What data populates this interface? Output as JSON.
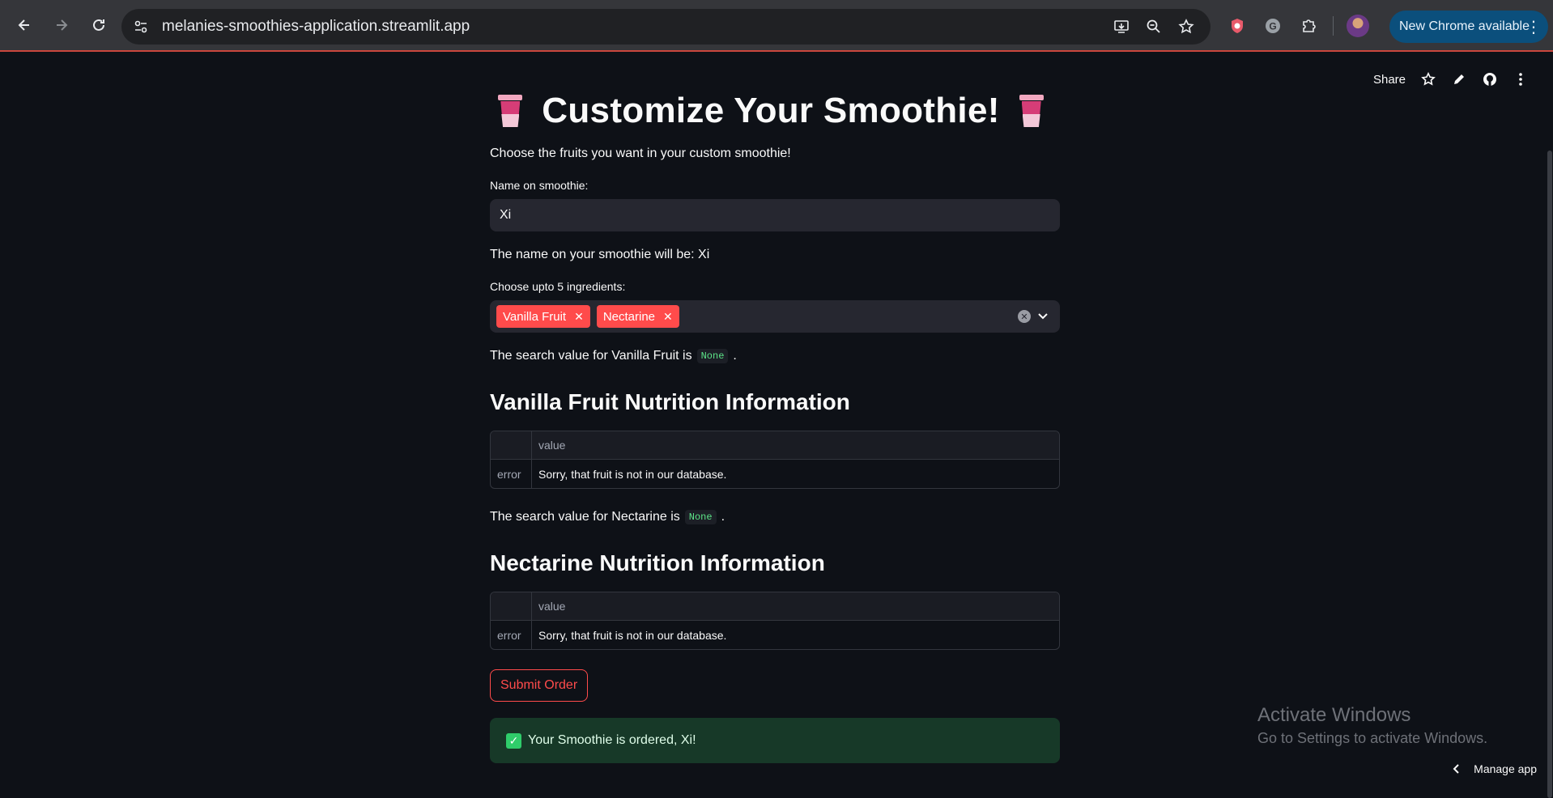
{
  "browser": {
    "url": "melanies-smoothies-application.streamlit.app",
    "update_label": "New Chrome available"
  },
  "toolbar": {
    "share_label": "Share"
  },
  "app": {
    "title": "Customize Your Smoothie!",
    "intro": "Choose the fruits you want in your custom smoothie!",
    "name_label": "Name on smoothie:",
    "name_value": "Xi",
    "name_display": "The name on your smoothie will be: Xi",
    "ingredients_label": "Choose upto 5 ingredients:",
    "selected": [
      "Vanilla Fruit",
      "Nectarine"
    ],
    "sections": [
      {
        "search_prefix": "The search value for Vanilla Fruit is",
        "search_value": "None",
        "search_suffix": ".",
        "heading": "Vanilla Fruit Nutrition Information",
        "table": {
          "columns": [
            "",
            "value"
          ],
          "rows": [
            [
              "error",
              "Sorry, that fruit is not in our database."
            ]
          ]
        }
      },
      {
        "search_prefix": "The search value for Nectarine is",
        "search_value": "None",
        "search_suffix": ".",
        "heading": "Nectarine Nutrition Information",
        "table": {
          "columns": [
            "",
            "value"
          ],
          "rows": [
            [
              "error",
              "Sorry, that fruit is not in our database."
            ]
          ]
        }
      }
    ],
    "submit_label": "Submit Order",
    "success_message": "Your Smoothie is ordered, Xi!"
  },
  "watermark": {
    "title": "Activate Windows",
    "subtitle": "Go to Settings to activate Windows."
  },
  "footer": {
    "manage_app": "Manage app"
  },
  "colors": {
    "background": "#0e1117",
    "primary": "#ff4b4b",
    "input_bg": "#262730",
    "success_bg": "#173928"
  }
}
